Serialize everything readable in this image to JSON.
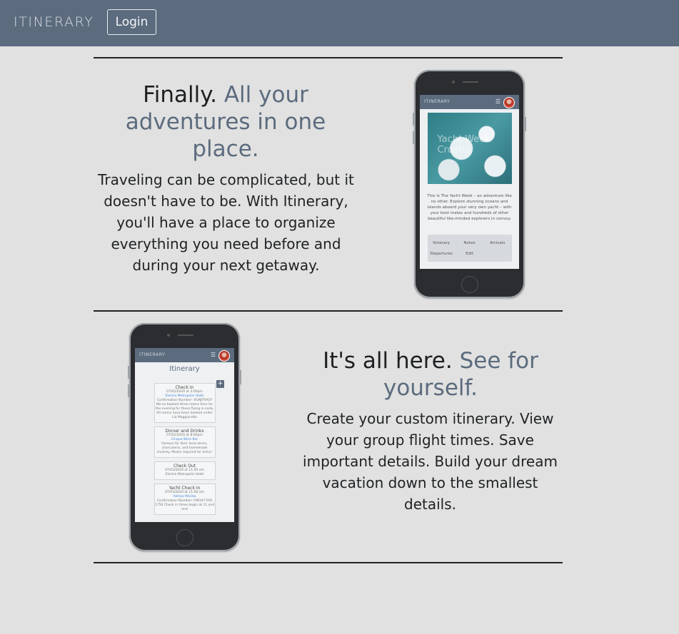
{
  "header": {
    "brand": "ITINERARY",
    "login_label": "Login"
  },
  "section1": {
    "title_lead": "Finally.",
    "title_accent": "All your adventures in one place.",
    "body": "Traveling can be complicated, but it doesn't have to be. With Itinerary, you'll have a place to organize everything you need before and during your next getaway.",
    "phone": {
      "brand": "ITINERARY",
      "hero_caption": "Yacht Week Croatia",
      "paragraph": "This is The Yacht Week – an adventure like no other. Explore stunning oceans and islands aboard your very own yacht – with your best mates and hundreds of other beautiful like-minded explorers in convoy.",
      "links": [
        "Itinerary",
        "Notes",
        "Arrivals",
        "Departures",
        "Edit"
      ]
    }
  },
  "section2": {
    "title_lead": "It's all here.",
    "title_accent": "See for yourself.",
    "body": "Create your custom itinerary. View your group flight times. Save important details. Build your dream vacation down to the smallest details.",
    "phone": {
      "brand": "ITINERARY",
      "heading": "Itinerary",
      "cards": [
        {
          "title": "Check In",
          "date": "07/02/2020 at 3:00pm",
          "link": "Electra Metropolis Hotel",
          "notes": "Confirmation Number: XGNJTRAGY We've booked three rooms here for the evening for those flying in early. All rooms have been booked under Lia Maggiorotto"
        },
        {
          "title": "Dinner and Drinks",
          "date": "07/02/2020 at 8:00pm",
          "link": "Cinque Wine Bar",
          "notes": "Famous for their local wines, charcuterie, and homemade chutney. Masks required for entry!"
        },
        {
          "title": "Check Out",
          "date": "07/03/2020 at 11:00 am",
          "link": "",
          "notes": "Electra Metropolis Hotel"
        },
        {
          "title": "Yacht Check In",
          "date": "07/03/2020 at 11:00 am",
          "link": "Alimos Marina",
          "notes": "Confirmation Number: HW347-RIO 1756 Check in times begin at 11 and end"
        }
      ]
    }
  }
}
